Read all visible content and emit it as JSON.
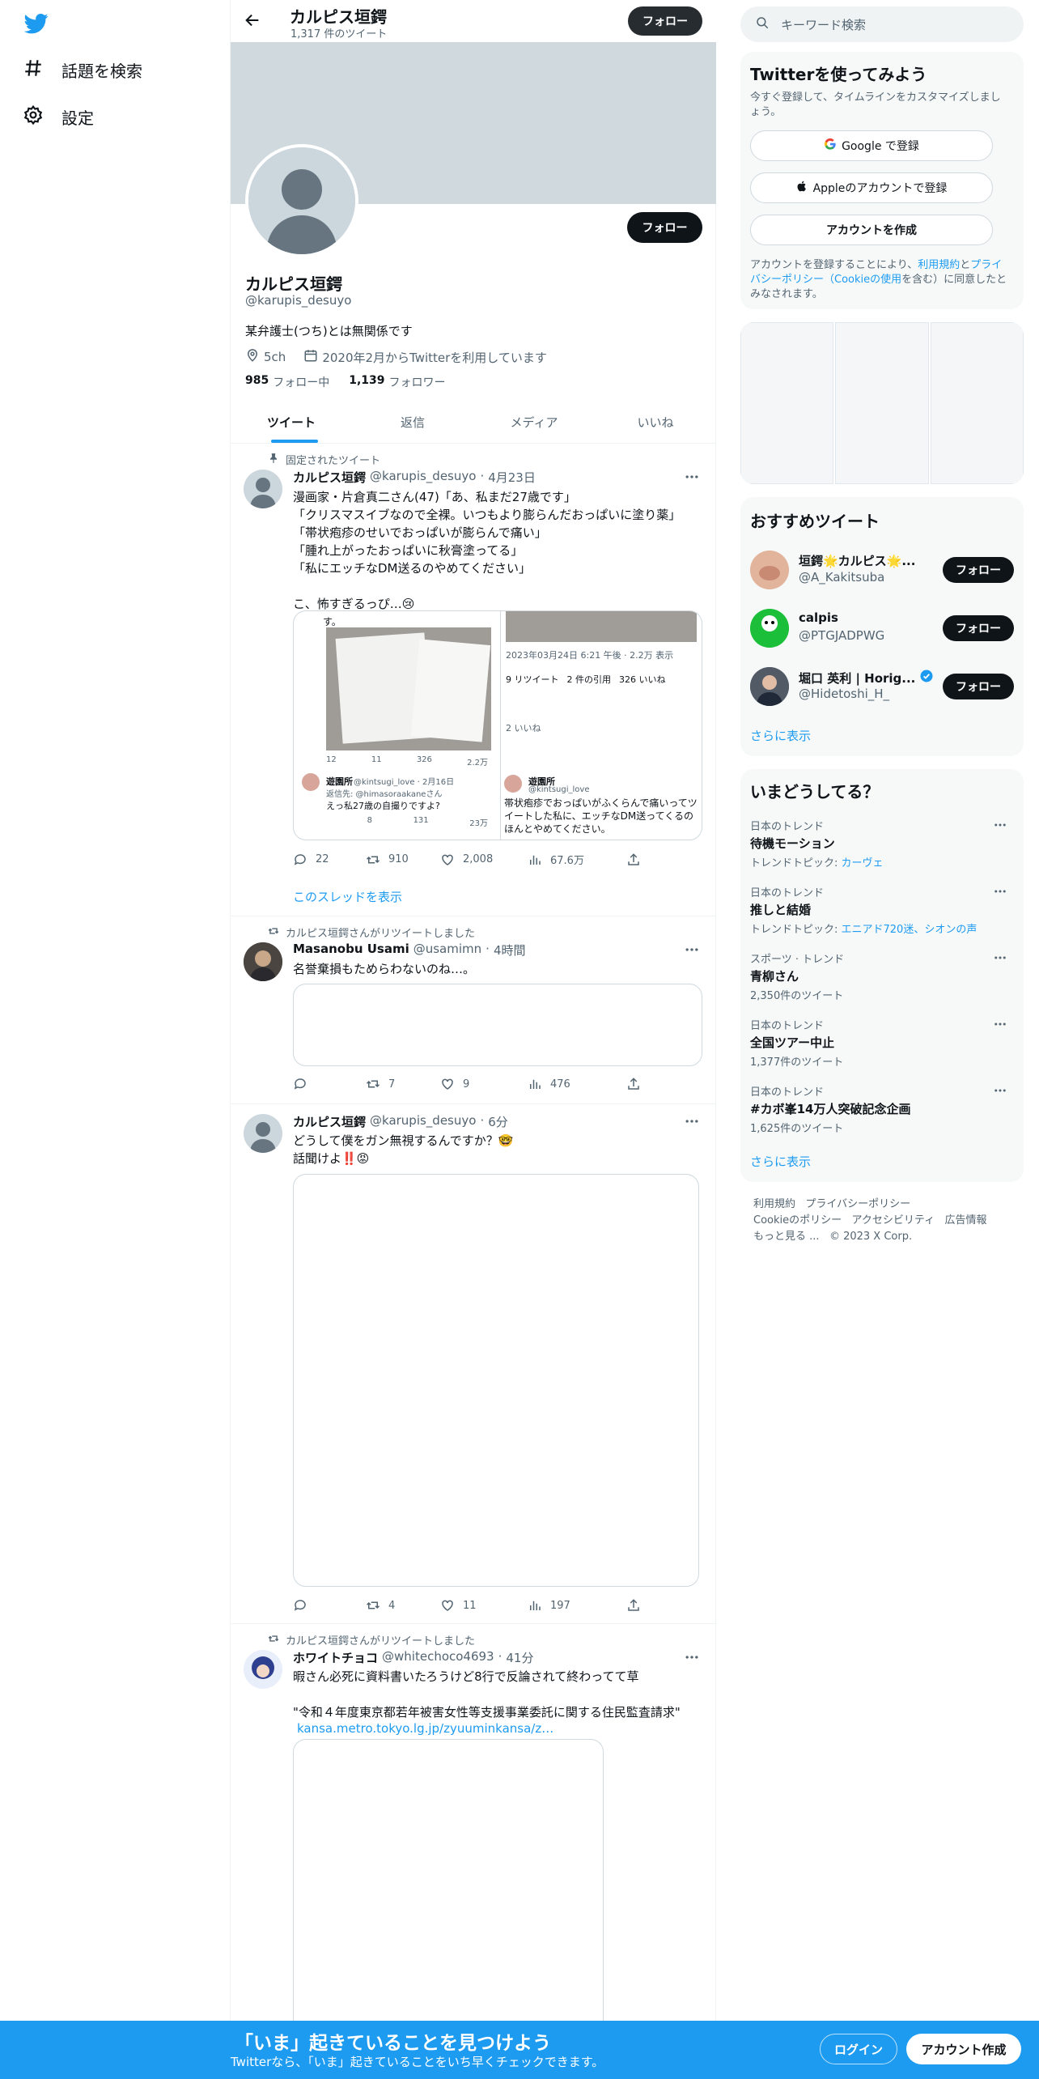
{
  "nav": {
    "explore_label": "話題を検索",
    "settings_label": "設定"
  },
  "header": {
    "name": "カルピス垣鍔",
    "tweet_count": "1,317 件のツイート",
    "follow_label": "フォロー"
  },
  "profile": {
    "name": "カルピス垣鍔",
    "handle": "@karupis_desuyo",
    "bio": "某弁護士(つち)とは無関係です",
    "location": "5ch",
    "joined": "2020年2月からTwitterを利用しています",
    "following_count": "985",
    "following_label": "フォロー中",
    "followers_count": "1,139",
    "followers_label": "フォロワー",
    "follow_label": "フォロー"
  },
  "tabs": [
    "ツイート",
    "返信",
    "メディア",
    "いいね"
  ],
  "tweets": [
    {
      "context": "固定されたツイート",
      "name": "カルピス垣鍔",
      "handle": "@karupis_desuyo",
      "time": "4月23日",
      "text": "漫画家・片倉真二さん(47)「あ、私まだ27歳です」\n「クリスマスイブなので全裸。いつもより膨らんだおっぱいに塗り薬」\n「帯状疱疹のせいでおっぱいが膨らんで痛い」\n「腫れ上がったおっぱいに秋膏塗ってる」\n「私にエッチなDM送るのやめてください」\n\nこ、怖すぎるっぴ…😢",
      "replies": "22",
      "retweets": "910",
      "likes": "2,008",
      "views": "67.6万",
      "show_thread": "このスレッドを表示",
      "embed": {
        "left_top": "す。",
        "left_stats": [
          "12",
          "11",
          "326",
          "2.2万"
        ],
        "left_reply_name": "遊園所",
        "left_reply_handle": "@kintsugi_love · 2月16日",
        "left_reply_to": "返信先: @himasoraakaneさん",
        "left_reply_text": "えっ私27歳の自撮りですよ?",
        "left_reply_stats": [
          "",
          "8",
          "131",
          "23万"
        ],
        "right_time": "2023年03月24日 6:21 午後 · 2.2万 表示",
        "right_rt": "9 リツイート",
        "right_quote": "2 件の引用",
        "right_likes": "326 いいね",
        "right_likes2": "2 いいね",
        "right_reply_name": "遊園所",
        "right_reply_handle": "@kintsugi_love",
        "right_reply_text": "帯状疱疹でおっぱいがふくらんで痛いってツイートした私に、エッチなDM送ってくるのほんとやめてください。"
      }
    },
    {
      "context": "カルピス垣鍔さんがリツイートしました",
      "name": "Masanobu Usami",
      "handle": "@usamimn",
      "time": "4時間",
      "text": "名誉棄損もためらわないのね…。",
      "replies": "",
      "retweets": "7",
      "likes": "9",
      "views": "476"
    },
    {
      "context": "",
      "name": "カルピス垣鍔",
      "handle": "@karupis_desuyo",
      "time": "6分",
      "text": "どうして僕をガン無視するんですか？🤓\n話聞けよ‼️😡",
      "replies": "",
      "retweets": "4",
      "likes": "11",
      "views": "197"
    },
    {
      "context": "カルピス垣鍔さんがリツイートしました",
      "name": "ホワイトチョコ",
      "handle": "@whitechoco4693",
      "time": "41分",
      "text": "暇さん必死に資料書いたろうけど8行で反論されて終わってて草\n\n\"令和４年度東京都若年被害女性等支援事業委託に関する住民監査請求\"",
      "link": "kansa.metro.tokyo.lg.jp/zyuuminkansa/z…"
    }
  ],
  "right": {
    "search_placeholder": "キーワード検索",
    "signup": {
      "title": "Twitterを使ってみよう",
      "desc": "今すぐ登録して、タイムラインをカスタマイズしましょう。",
      "google": "Google で登録",
      "apple": "Appleのアカウントで登録",
      "create": "アカウントを作成",
      "terms_pre": "アカウントを登録することにより、",
      "terms_link": "利用規約",
      "terms_mid": "と",
      "privacy_link": "プライバシーポリシー",
      "cookie_link": "（Cookieの使用",
      "terms_post": "を含む）に同意したとみなされます。"
    },
    "who_to_follow": {
      "title": "おすすめツイート",
      "users": [
        {
          "name": "垣鍔🌟カルピス🌟...",
          "handle": "@A_Kakitsuba",
          "follow": "フォロー"
        },
        {
          "name": "calpis",
          "handle": "@PTGJADPWG",
          "follow": "フォロー"
        },
        {
          "name": "堀口 英利 | Horig...",
          "handle": "@Hidetoshi_H_",
          "follow": "フォロー"
        }
      ],
      "more": "さらに表示"
    },
    "trends": {
      "title": "いまどうしてる？",
      "items": [
        {
          "category": "日本のトレンド",
          "name": "待機モーション",
          "sub_pre": "トレンドトピック: ",
          "sub_link": "カーヴェ"
        },
        {
          "category": "日本のトレンド",
          "name": "推しと結婚",
          "sub_pre": "トレンドトピック: ",
          "sub_link": "エニアド720迷、シオンの声"
        },
        {
          "category": "スポーツ · トレンド",
          "name": "青柳さん",
          "sub_pre": "2,350件のツイート",
          "sub_link": ""
        },
        {
          "category": "日本のトレンド",
          "name": "全国ツアー中止",
          "sub_pre": "1,377件のツイート",
          "sub_link": ""
        },
        {
          "category": "日本のトレンド",
          "name": "#カボ峯14万人突破記念企画",
          "sub_pre": "1,625件のツイート",
          "sub_link": ""
        }
      ],
      "more": "さらに表示"
    },
    "footer": {
      "l1a": "利用規約",
      "l1b": "プライバシーポリシー",
      "l2a": "Cookieのポリシー",
      "l2b": "アクセシビリティ",
      "l2c": "広告情報",
      "l3a": "もっと見る ...",
      "l3b": "© 2023 X Corp."
    }
  },
  "banner": {
    "title": "「いま」起きていることを見つけよう",
    "subtitle": "Twitterなら、「いま」起きていることをいち早くチェックできます。",
    "login": "ログイン",
    "signup": "アカウント作成"
  },
  "colors": {
    "accent": "#1d9bf0",
    "text": "#0f1419",
    "muted": "#536471",
    "banner_bg": "#cfd9de"
  }
}
